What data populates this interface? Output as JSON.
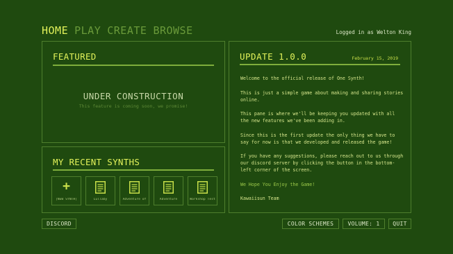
{
  "nav": {
    "home": "HOME",
    "play": "PLAY",
    "create": "CREATE",
    "browse": "BROWSE"
  },
  "user": {
    "logged_in_text": "Logged in as Welton King"
  },
  "featured": {
    "title": "FEATURED",
    "status": "UNDER CONSTRUCTION",
    "subtext": "This feature is coming soon, we promise!"
  },
  "recent": {
    "title": "MY RECENT SYNTHS",
    "new_label": "[NEW SYNTH]",
    "items": [
      "Lullaby",
      "Adventure of",
      "Adventure",
      "Workshop Test"
    ]
  },
  "update": {
    "title": "UPDATE 1.0.0",
    "date": "February 15, 2019",
    "paragraphs": [
      "Welcome to the official release of One Synth!",
      "This is just a simple game about making and sharing stories online.",
      "This pane is where we'll be keeping you updated with all the new features we've been adding in.",
      "Since this is the first update the only thing we have to say for now is that we developed and released the game!",
      "If you have any suggestions, please reach out to us through our discord server by clicking the button in the bottom-left corner of the screen."
    ],
    "closing": "We Hope You Enjoy the Game!",
    "signature": "Kawaiisun Team"
  },
  "buttons": {
    "discord": "DISCORD",
    "color_schemes": "COLOR SCHEMES",
    "volume": "VOLUME: 1",
    "quit": "QUIT"
  },
  "colors": {
    "background": "#1f4a0f",
    "accent": "#e2f25a",
    "border": "#4f7f2d",
    "inactive_nav": "#6a9a3a"
  }
}
